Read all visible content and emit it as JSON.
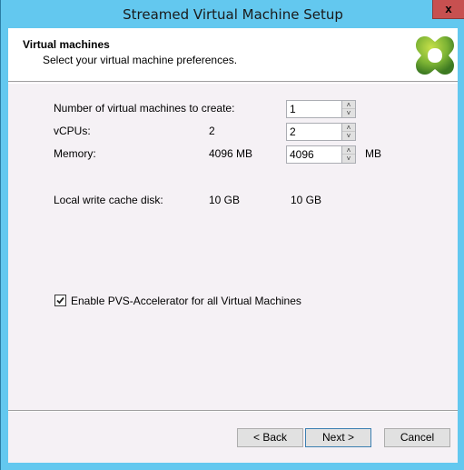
{
  "window": {
    "title": "Streamed Virtual Machine Setup",
    "close_icon": "x"
  },
  "header": {
    "title": "Virtual machines",
    "subtitle": "Select your virtual machine preferences.",
    "logo_icon": "citrix-logo"
  },
  "form": {
    "num_vms": {
      "label": "Number of virtual machines to create:",
      "value": "1"
    },
    "vcpus": {
      "label": "vCPUs:",
      "default": "2",
      "value": "2"
    },
    "memory": {
      "label": "Memory:",
      "default": "4096 MB",
      "value": "4096",
      "unit": "MB"
    },
    "write_cache": {
      "label": "Local write cache disk:",
      "default": "10 GB",
      "value": "10 GB"
    },
    "pvs_accelerator": {
      "label": "Enable PVS-Accelerator for all Virtual Machines",
      "checked": true
    },
    "spin_up": "˄",
    "spin_down": "˅"
  },
  "buttons": {
    "back": "< Back",
    "next": "Next >",
    "cancel": "Cancel"
  },
  "colors": {
    "titlebar": "#63c8ef",
    "close": "#c75050",
    "client_bg": "#f5f1f5",
    "logo_green": "#6aa82c"
  }
}
